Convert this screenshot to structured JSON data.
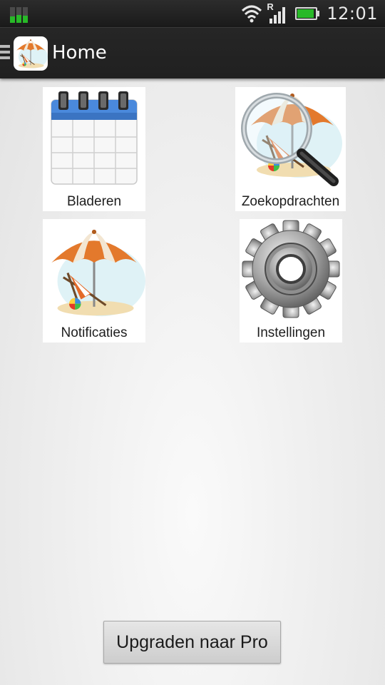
{
  "status_bar": {
    "time": "12:01",
    "notification_icon": "signal-activity-icon",
    "icons": [
      "wifi-icon",
      "cell-signal-roaming-icon",
      "battery-icon"
    ],
    "roaming_indicator": "R",
    "battery_level": 0.9,
    "accent_color": "#28b928"
  },
  "action_bar": {
    "menu_icon": "hamburger-icon",
    "app_icon": "beach-umbrella-icon",
    "title": "Home"
  },
  "menu": {
    "items": [
      {
        "label": "Bladeren",
        "icon": "calendar-icon"
      },
      {
        "label": "Zoekopdrachten",
        "icon": "magnifier-beach-icon"
      },
      {
        "label": "Notificaties",
        "icon": "beach-chair-umbrella-icon"
      },
      {
        "label": "Instellingen",
        "icon": "gear-icon"
      }
    ]
  },
  "upgrade_button": {
    "label": "Upgraden naar Pro"
  }
}
